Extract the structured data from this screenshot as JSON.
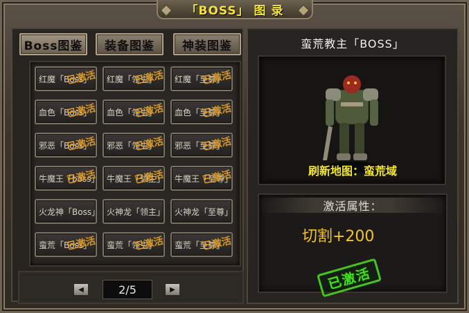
{
  "title": "「BOSS」 图 录",
  "tabs": [
    {
      "label": "Boss图鉴"
    },
    {
      "label": "装备图鉴"
    },
    {
      "label": "神装图鉴"
    }
  ],
  "grid": {
    "rows": [
      [
        "红魔「Boss」",
        "红魔「领主」",
        "红魔「至尊」"
      ],
      [
        "血色「Boss」",
        "血色「领主」",
        "血色「至尊」"
      ],
      [
        "邪恶「Boss」",
        "邪恶「领主」",
        "邪恶「至尊」"
      ],
      [
        "牛魔王「boss」",
        "牛魔王「领主」",
        "牛魔王「至尊」"
      ],
      [
        "火龙神「Boss」",
        "火神龙「领主」",
        "火神龙「至尊」"
      ],
      [
        "蛮荒「Boss」",
        "蛮荒「领主」",
        "蛮荒「至尊」"
      ]
    ],
    "activated_seal": "已激活"
  },
  "pager": {
    "prev_icon": "◀",
    "next_icon": "▶",
    "page": "2/5"
  },
  "detail": {
    "boss_name": "蛮荒教主「BOSS」",
    "map_label": "刷新地图：蛮荒域",
    "attr_header": "激活属性：",
    "attr_value": "切割+200",
    "stamp": "已激活"
  }
}
